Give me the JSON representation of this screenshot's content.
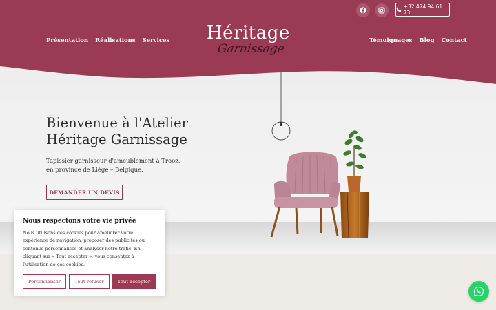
{
  "brand": {
    "logo_line1": "Héritage",
    "logo_line2": "Garnissage"
  },
  "header": {
    "phone_label": "+32 474 94 61 73",
    "nav_left": [
      "Présentation",
      "Réalisations",
      "Services"
    ],
    "nav_right": [
      "Témoignages",
      "Blog",
      "Contact"
    ],
    "social_icons": [
      "facebook-icon",
      "instagram-icon"
    ]
  },
  "hero": {
    "title_line1": "Bienvenue à l'Atelier",
    "title_line2": "Héritage Garnissage",
    "subtitle_line1": "Tapissier garnisseur d'ameublement à Trooz,",
    "subtitle_line2": "en province de Liège – Belgique.",
    "cta_label": "DEMANDER UN DEVIS"
  },
  "cookie_banner": {
    "title": "Nous respectons votre vie privée",
    "text_lines": [
      "Nous utilisons des cookies pour améliorer votre",
      "expérience de navigation, proposer des publicités ou",
      "contenus personnalisés et analyser notre trafic. En",
      "cliquant sur « Tout accepter », vous consentez à",
      "l'utilisation de ces cookies."
    ],
    "btn_customize": "Personnaliser",
    "btn_refuse": "Tout refuser",
    "btn_accept": "Tout accepter"
  },
  "colors": {
    "brand": "#9b3a55",
    "whatsapp": "#25d366",
    "background": "#efebe6"
  },
  "floating": {
    "whatsapp_icon": "whatsapp-icon"
  }
}
